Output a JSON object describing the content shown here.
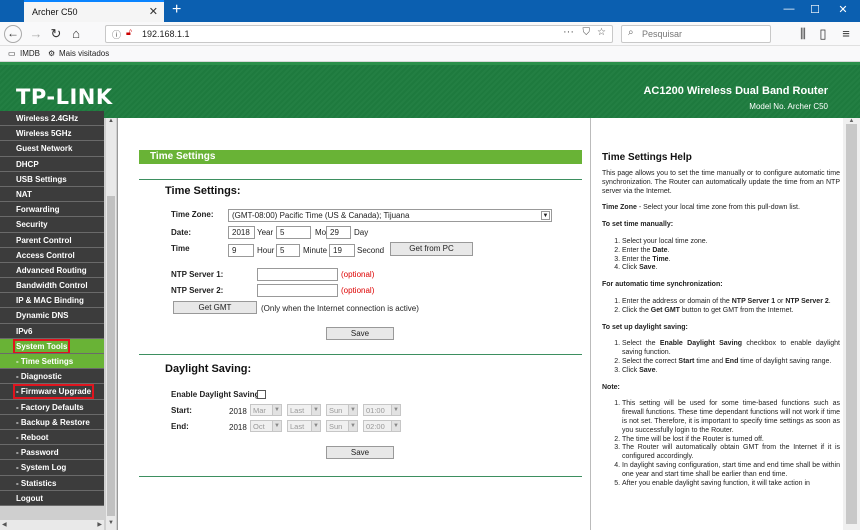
{
  "browser": {
    "tab_title": "Archer C50",
    "tab_close": "✕",
    "new_tab": "+",
    "url": "192.168.1.1",
    "search_placeholder": "Pesquisar",
    "bookmarks": [
      "IMDB",
      "Mais visitados"
    ],
    "window_controls": [
      "—",
      "☐",
      "✕"
    ]
  },
  "header": {
    "logo": "TP-LINK",
    "product": "AC1200 Wireless Dual Band Router",
    "model": "Model No. Archer C50"
  },
  "sidebar": {
    "items": [
      {
        "label": "Wireless 2.4GHz",
        "state": "normal"
      },
      {
        "label": "Wireless 5GHz",
        "state": "normal"
      },
      {
        "label": "Guest Network",
        "state": "normal"
      },
      {
        "label": "DHCP",
        "state": "normal"
      },
      {
        "label": "USB Settings",
        "state": "normal"
      },
      {
        "label": "NAT",
        "state": "normal"
      },
      {
        "label": "Forwarding",
        "state": "normal"
      },
      {
        "label": "Security",
        "state": "normal"
      },
      {
        "label": "Parent Control",
        "state": "normal"
      },
      {
        "label": "Access Control",
        "state": "normal"
      },
      {
        "label": "Advanced Routing",
        "state": "normal"
      },
      {
        "label": "Bandwidth Control",
        "state": "normal"
      },
      {
        "label": "IP & MAC Binding",
        "state": "normal"
      },
      {
        "label": "Dynamic DNS",
        "state": "normal"
      },
      {
        "label": "IPv6",
        "state": "normal"
      },
      {
        "label": "System Tools",
        "state": "active-boxed"
      },
      {
        "label": "- Time Settings",
        "state": "subactive"
      },
      {
        "label": "- Diagnostic",
        "state": "sub"
      },
      {
        "label": "- Firmware Upgrade",
        "state": "sub-boxed"
      },
      {
        "label": "- Factory Defaults",
        "state": "sub"
      },
      {
        "label": "- Backup & Restore",
        "state": "sub"
      },
      {
        "label": "- Reboot",
        "state": "sub"
      },
      {
        "label": "- Password",
        "state": "sub"
      },
      {
        "label": "- System Log",
        "state": "sub"
      },
      {
        "label": "- Statistics",
        "state": "sub"
      },
      {
        "label": "Logout",
        "state": "normal"
      }
    ],
    "scroll_up": "▲",
    "scroll_down": "▼",
    "hscroll_left": "◀",
    "hscroll_right": "▶"
  },
  "main": {
    "section_title": "Time Settings",
    "time_heading": "Time Settings:",
    "timezone_label": "Time Zone:",
    "timezone_value": "(GMT-08:00) Pacific Time (US & Canada); Tijuana",
    "date_label": "Date:",
    "date_year": "2018",
    "year_label": "Year",
    "date_month": "5",
    "month_label": "Month",
    "date_day": "29",
    "day_label": "Day",
    "time_label": "Time",
    "time_hour": "9",
    "hour_label": "Hour",
    "time_minute": "5",
    "minute_label": "Minute",
    "time_second": "19",
    "second_label": "Second",
    "get_from_pc": "Get from PC",
    "ntp1_label": "NTP Server 1:",
    "ntp2_label": "NTP Server 2:",
    "optional": "(optional)",
    "get_gmt": "Get GMT",
    "gmt_note": "(Only when the Internet connection is active)",
    "save": "Save",
    "dst_heading": "Daylight Saving:",
    "dst_enable_label": "Enable Daylight Saving:",
    "start_label": "Start:",
    "end_label": "End:",
    "start": {
      "year": "2018",
      "month": "Mar",
      "week": "Last",
      "day": "Sun",
      "time": "01:00"
    },
    "end": {
      "year": "2018",
      "month": "Oct",
      "week": "Last",
      "day": "Sun",
      "time": "02:00"
    },
    "save2": "Save"
  },
  "help": {
    "title": "Time Settings Help",
    "intro": "This page allows you to set the time manually or to configure automatic time synchronization. The Router can automatically update the time from an NTP server via the Internet.",
    "tz_term": "Time Zone",
    "tz_desc": " - Select your local time zone from this pull-down list.",
    "manual_heading": "To set time manually:",
    "manual_1": "Select your local time zone.",
    "manual_2_pre": "Enter the ",
    "manual_2_b": "Date",
    "manual_3_pre": "Enter the ",
    "manual_3_b": "Time",
    "manual_4_pre": "Click ",
    "manual_4_b": "Save",
    "auto_heading": "For automatic time synchronization:",
    "auto_1_pre": "Enter the address or domain of the ",
    "auto_1_b1": "NTP Server 1",
    "auto_1_mid": " or ",
    "auto_1_b2": "NTP Server 2",
    "auto_2_pre": "Click the ",
    "auto_2_b": "Get GMT",
    "auto_2_post": " button to get GMT from the Internet.",
    "dst_heading": "To set up daylight saving:",
    "dst_1_pre": "Select the ",
    "dst_1_b": "Enable Daylight Saving",
    "dst_1_post": " checkbox to enable daylight saving function.",
    "dst_2_pre": "Select the correct ",
    "dst_2_b1": "Start",
    "dst_2_mid": " time and ",
    "dst_2_b2": "End",
    "dst_2_post": " time of daylight saving range.",
    "dst_3_pre": "Click ",
    "dst_3_b": "Save",
    "note_heading": "Note:",
    "note_1": "This setting will be used for some time-based functions such as firewall functions. These time dependant functions will not work if time is not set. Therefore, it is important to specify time settings as soon as you successfully login to the Router.",
    "note_2": "The time will be lost if the Router is turned off.",
    "note_3": "The Router will automatically obtain GMT from the Internet if it is configured accordingly.",
    "note_4": "In daylight saving configuration, start time and end time shall be within one year and start time shall be earlier than end time.",
    "note_5": "After you enable daylight saving function, it will take action in"
  }
}
